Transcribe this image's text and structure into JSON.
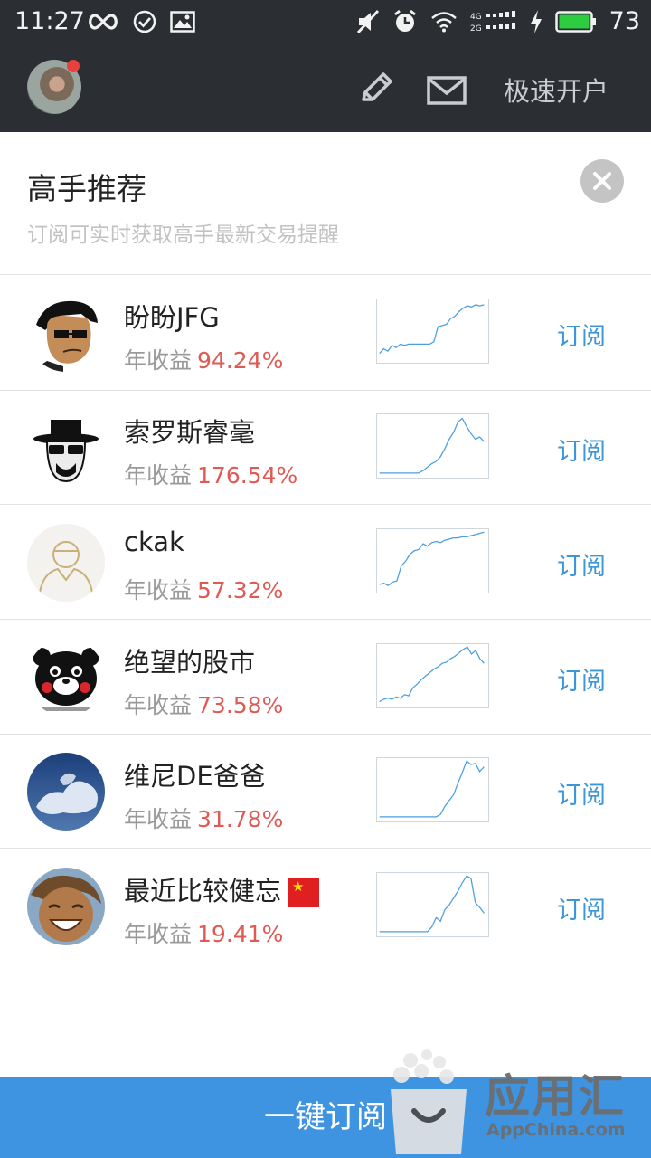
{
  "status_bar": {
    "time": "11:27",
    "battery": "73"
  },
  "header": {
    "open_account": "极速开户"
  },
  "card": {
    "title": "高手推荐",
    "subtitle": "订阅可实时获取高手最新交易提醒"
  },
  "traders": [
    {
      "name": "盼盼JFG",
      "income_label": "年收益",
      "income": "94.24%",
      "subscribe": "订阅",
      "spark": [
        0.9,
        0.82,
        0.86,
        0.76,
        0.8,
        0.74,
        0.76,
        0.74,
        0.74,
        0.74,
        0.74,
        0.74,
        0.74,
        0.7,
        0.44,
        0.42,
        0.4,
        0.3,
        0.26,
        0.18,
        0.12,
        0.08,
        0.1,
        0.06,
        0.08,
        0.06
      ]
    },
    {
      "name": "索罗斯睿毫",
      "income_label": "年收益",
      "income": "176.54%",
      "subscribe": "订阅",
      "spark": [
        0.98,
        0.98,
        0.98,
        0.98,
        0.98,
        0.98,
        0.98,
        0.98,
        0.98,
        0.98,
        0.94,
        0.88,
        0.82,
        0.78,
        0.7,
        0.56,
        0.4,
        0.28,
        0.1,
        0.04,
        0.18,
        0.3,
        0.4,
        0.36,
        0.44
      ]
    },
    {
      "name": "ckak",
      "income_label": "年收益",
      "income": "57.32%",
      "subscribe": "订阅",
      "spark": [
        0.92,
        0.9,
        0.94,
        0.88,
        0.86,
        0.6,
        0.52,
        0.4,
        0.34,
        0.32,
        0.22,
        0.26,
        0.2,
        0.18,
        0.2,
        0.16,
        0.14,
        0.12,
        0.12,
        0.1,
        0.1,
        0.08,
        0.06,
        0.04,
        0.02
      ]
    },
    {
      "name": "绝望的股市",
      "income_label": "年收益",
      "income": "73.58%",
      "subscribe": "订阅",
      "spark": [
        0.96,
        0.92,
        0.9,
        0.92,
        0.88,
        0.9,
        0.84,
        0.86,
        0.72,
        0.66,
        0.58,
        0.52,
        0.46,
        0.4,
        0.36,
        0.3,
        0.28,
        0.22,
        0.18,
        0.12,
        0.06,
        0.02,
        0.14,
        0.08,
        0.22,
        0.3
      ]
    },
    {
      "name": "维尼DE爸爸",
      "income_label": "年收益",
      "income": "31.78%",
      "subscribe": "订阅",
      "spark": [
        0.98,
        0.98,
        0.98,
        0.98,
        0.98,
        0.98,
        0.98,
        0.98,
        0.98,
        0.98,
        0.98,
        0.98,
        0.98,
        0.98,
        0.94,
        0.8,
        0.7,
        0.6,
        0.4,
        0.22,
        0.02,
        0.08,
        0.06,
        0.2,
        0.12
      ]
    },
    {
      "name": "最近比较健忘",
      "income_label": "年收益",
      "income": "19.41%",
      "subscribe": "订阅",
      "spark": [
        0.98,
        0.98,
        0.98,
        0.98,
        0.98,
        0.98,
        0.98,
        0.98,
        0.98,
        0.98,
        0.98,
        0.98,
        0.9,
        0.74,
        0.8,
        0.6,
        0.52,
        0.4,
        0.28,
        0.14,
        0.02,
        0.06,
        0.48,
        0.56,
        0.66
      ],
      "flag": true
    }
  ],
  "bottom": {
    "subscribe_all": "一键订阅"
  },
  "watermark": {
    "brand": "应用汇",
    "domain": "AppChina.com"
  }
}
